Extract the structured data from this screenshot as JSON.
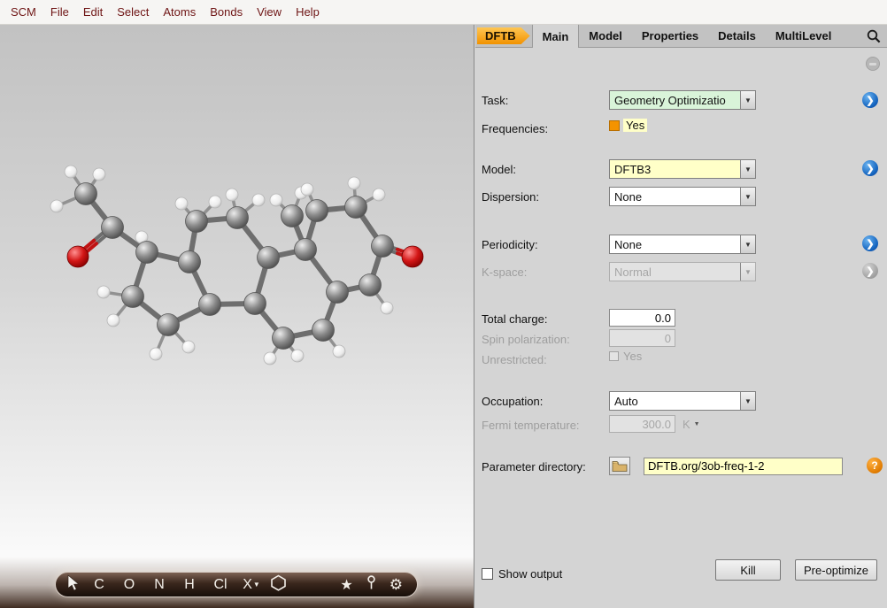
{
  "menu": {
    "items": [
      "SCM",
      "File",
      "Edit",
      "Select",
      "Atoms",
      "Bonds",
      "View",
      "Help"
    ]
  },
  "tabs": {
    "product": "DFTB",
    "items": [
      {
        "label": "Main",
        "active": true
      },
      {
        "label": "Model",
        "active": false
      },
      {
        "label": "Properties",
        "active": false
      },
      {
        "label": "Details",
        "active": false
      },
      {
        "label": "MultiLevel",
        "active": false
      }
    ]
  },
  "form": {
    "task": {
      "label": "Task:",
      "value": "Geometry Optimizatio"
    },
    "frequencies": {
      "label": "Frequencies:",
      "value": "Yes",
      "checked": true
    },
    "model": {
      "label": "Model:",
      "value": "DFTB3"
    },
    "dispersion": {
      "label": "Dispersion:",
      "value": "None"
    },
    "periodicity": {
      "label": "Periodicity:",
      "value": "None"
    },
    "kspace": {
      "label": "K-space:",
      "value": "Normal",
      "disabled": true
    },
    "total_charge": {
      "label": "Total charge:",
      "value": "0.0"
    },
    "spin_polarization": {
      "label": "Spin polarization:",
      "value": "0",
      "disabled": true
    },
    "unrestricted": {
      "label": "Unrestricted:",
      "value": "Yes",
      "checked": false,
      "disabled": true
    },
    "occupation": {
      "label": "Occupation:",
      "value": "Auto"
    },
    "fermi_temperature": {
      "label": "Fermi temperature:",
      "value": "300.0",
      "unit": "K",
      "disabled": true
    },
    "parameter_directory": {
      "label": "Parameter directory:",
      "value": "DFTB.org/3ob-freq-1-2"
    },
    "show_output": {
      "label": "Show output",
      "checked": false
    }
  },
  "actions": {
    "kill": "Kill",
    "preoptimize": "Pre-optimize",
    "help": "?"
  },
  "toolbar": {
    "elements": [
      "C",
      "O",
      "N",
      "H",
      "Cl",
      "X"
    ]
  },
  "colors": {
    "tab_orange": "#f29200",
    "combo_green": "#d9f4d9",
    "combo_yellow": "#ffffc8",
    "arrow_blue": "#1565c0",
    "checkbox_orange": "#f59300",
    "carbon": "#7a7a7a",
    "oxygen": "#cc1111",
    "hydrogen": "#ffffff"
  }
}
